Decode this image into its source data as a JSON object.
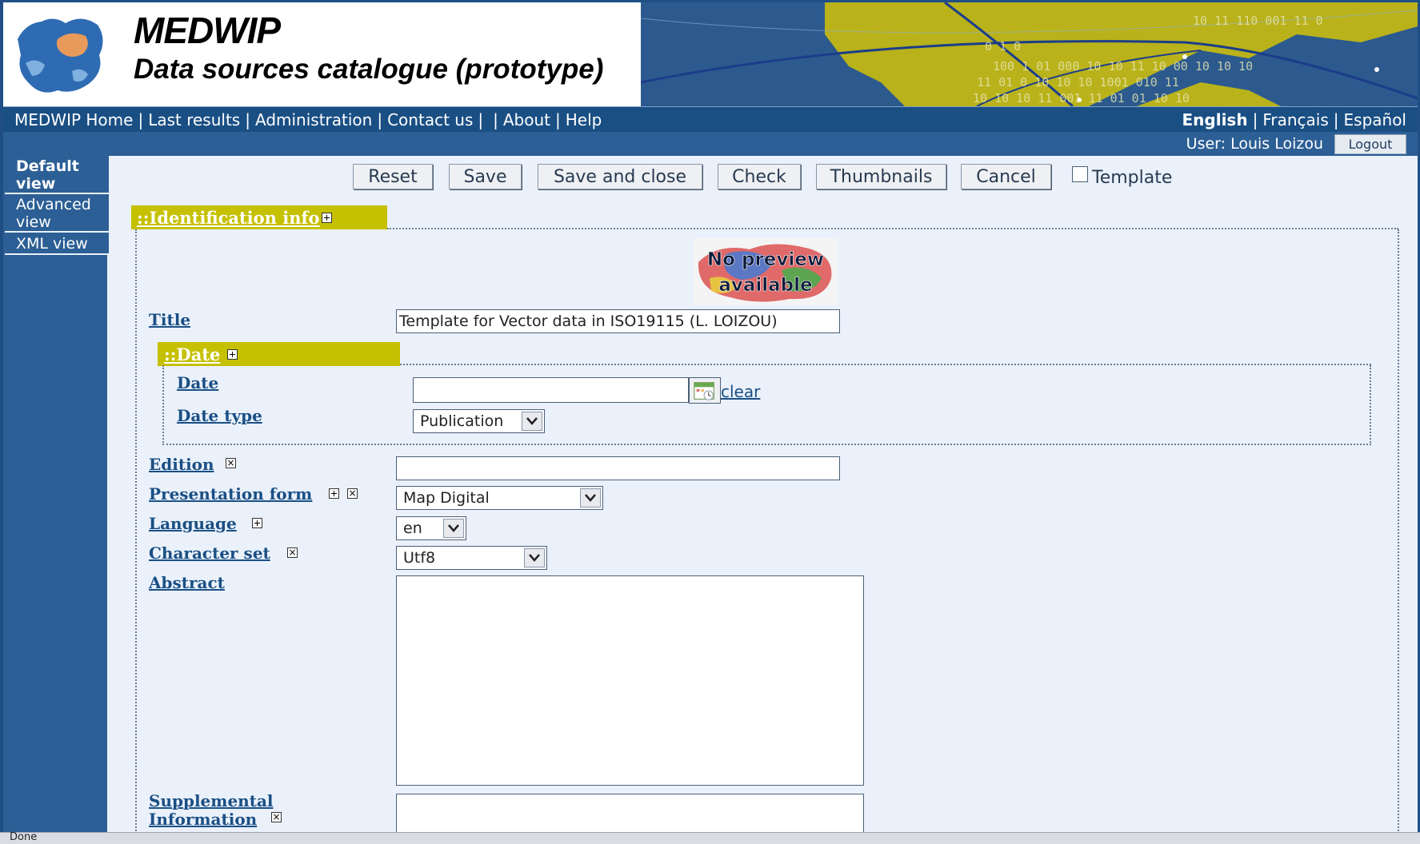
{
  "banner": {
    "title": "MEDWIP",
    "subtitle": "Data sources catalogue (prototype)",
    "map_text_lines": [
      "10 11 110 001 11 0",
      "0 1 0",
      "100 1 01 000 10 10 11 10 00 10 10 10",
      "11 01 0 10 10 10 1001 010 11",
      "10 10 10 11 001 11 01 01 10 10"
    ]
  },
  "nav": {
    "links": [
      "MEDWIP Home",
      "Last results",
      "Administration",
      "Contact us",
      "",
      "About",
      "Help"
    ],
    "languages": [
      "English",
      "Français",
      "Español"
    ],
    "active_language": "English"
  },
  "user": {
    "label": "User: Louis Loizou",
    "logout": "Logout"
  },
  "sidebar": {
    "items": [
      {
        "label": "Default view"
      },
      {
        "label": "Advanced view"
      },
      {
        "label": "XML view"
      }
    ]
  },
  "toolbar": {
    "reset": "Reset",
    "save": "Save",
    "save_close": "Save and close",
    "check": "Check",
    "thumbnails": "Thumbnails",
    "cancel": "Cancel",
    "template_label": "Template",
    "template_checked": false
  },
  "identification": {
    "header": "::Identification info",
    "preview_text": "No preview available",
    "title_label": "Title",
    "title_value": "Template for Vector data in ISO19115 (L. LOIZOU)",
    "date_section": {
      "header": "::Date",
      "date_label": "Date",
      "date_value": "",
      "clear": "clear",
      "date_type_label": "Date type",
      "date_type_value": "Publication"
    },
    "edition_label": "Edition",
    "edition_value": "",
    "presentation_label": "Presentation form",
    "presentation_value": "Map Digital",
    "language_label": "Language",
    "language_value": "en",
    "charset_label": "Character set",
    "charset_value": "Utf8",
    "abstract_label": "Abstract",
    "abstract_value": "",
    "supplemental_label": "Supplemental Information",
    "supplemental_value": ""
  },
  "status": {
    "text": "Done"
  },
  "colors": {
    "nav_bg": "#1a4f84",
    "sidebar_bg": "#2c5f95",
    "section_header": "#c5c000",
    "content_bg": "#eaf1fb",
    "link": "#1a4f84"
  }
}
